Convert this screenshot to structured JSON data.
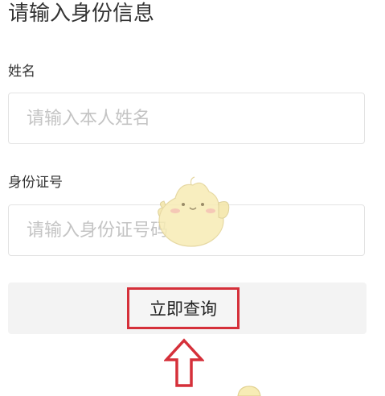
{
  "page": {
    "title": "请输入身份信息"
  },
  "form": {
    "name_label": "姓名",
    "name_placeholder": "请输入本人姓名",
    "name_value": "",
    "id_label": "身份证号",
    "id_placeholder": "请输入身份证号码",
    "id_value": ""
  },
  "submit": {
    "label": "立即查询"
  },
  "colors": {
    "highlight_box": "#d5303a",
    "arrow": "#d5303a",
    "mascot": "#f6e9a8"
  },
  "icons": {
    "arrow": "up-arrow-icon",
    "mascot": "chick-mascot-icon"
  }
}
